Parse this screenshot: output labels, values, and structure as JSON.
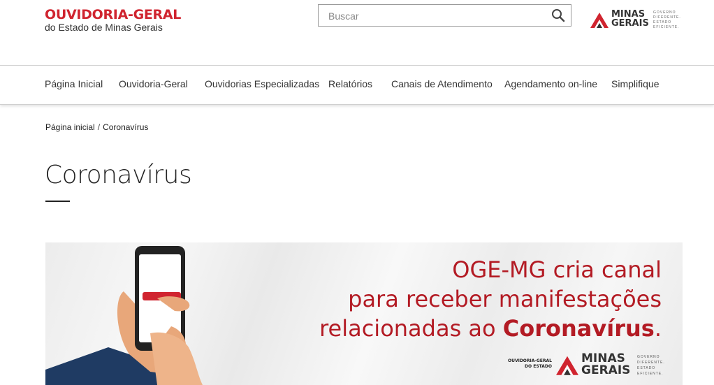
{
  "header": {
    "brand_title": "OUVIDORIA-GERAL",
    "brand_subtitle": "do Estado de Minas Gerais",
    "search": {
      "placeholder": "Buscar",
      "value": "",
      "icon": "search-icon"
    },
    "gov_logo": {
      "word_line1": "MINAS",
      "word_line2": "GERAIS",
      "tag_line1": "GOVERNO",
      "tag_line2": "DIFERENTE.",
      "tag_line3": "ESTADO",
      "tag_line4": "EFICIENTE."
    }
  },
  "nav": {
    "items": [
      {
        "label": "Página Inicial"
      },
      {
        "label": "Ouvidoria-Geral"
      },
      {
        "label": "Ouvidorias Especializadas"
      },
      {
        "label": "Relatórios"
      },
      {
        "label": "Canais de Atendimento"
      },
      {
        "label": "Agendamento on-line"
      },
      {
        "label": "Simplifique"
      }
    ]
  },
  "breadcrumb": {
    "home": "Página inicial",
    "separator": "/",
    "current": "Coronavírus"
  },
  "page": {
    "title": "Coronavírus"
  },
  "banner": {
    "line1": "OGE-MG cria canal",
    "line2": "para receber manifestações",
    "line3_prefix": "relacionadas ao ",
    "line3_bold": "Coronavírus",
    "line3_suffix": ".",
    "logo_oge_line1": "OUVIDORIA-GERAL",
    "logo_oge_line2": "DO ESTADO",
    "logo_mg_line1": "MINAS",
    "logo_mg_line2": "GERAIS",
    "logo_tag_line1": "GOVERNO",
    "logo_tag_line2": "DIFERENTE.",
    "logo_tag_line3": "ESTADO",
    "logo_tag_line4": "EFICIENTE."
  },
  "colors": {
    "brand_red": "#d0242f",
    "banner_red": "#b31b24",
    "text_dark": "#222222"
  }
}
